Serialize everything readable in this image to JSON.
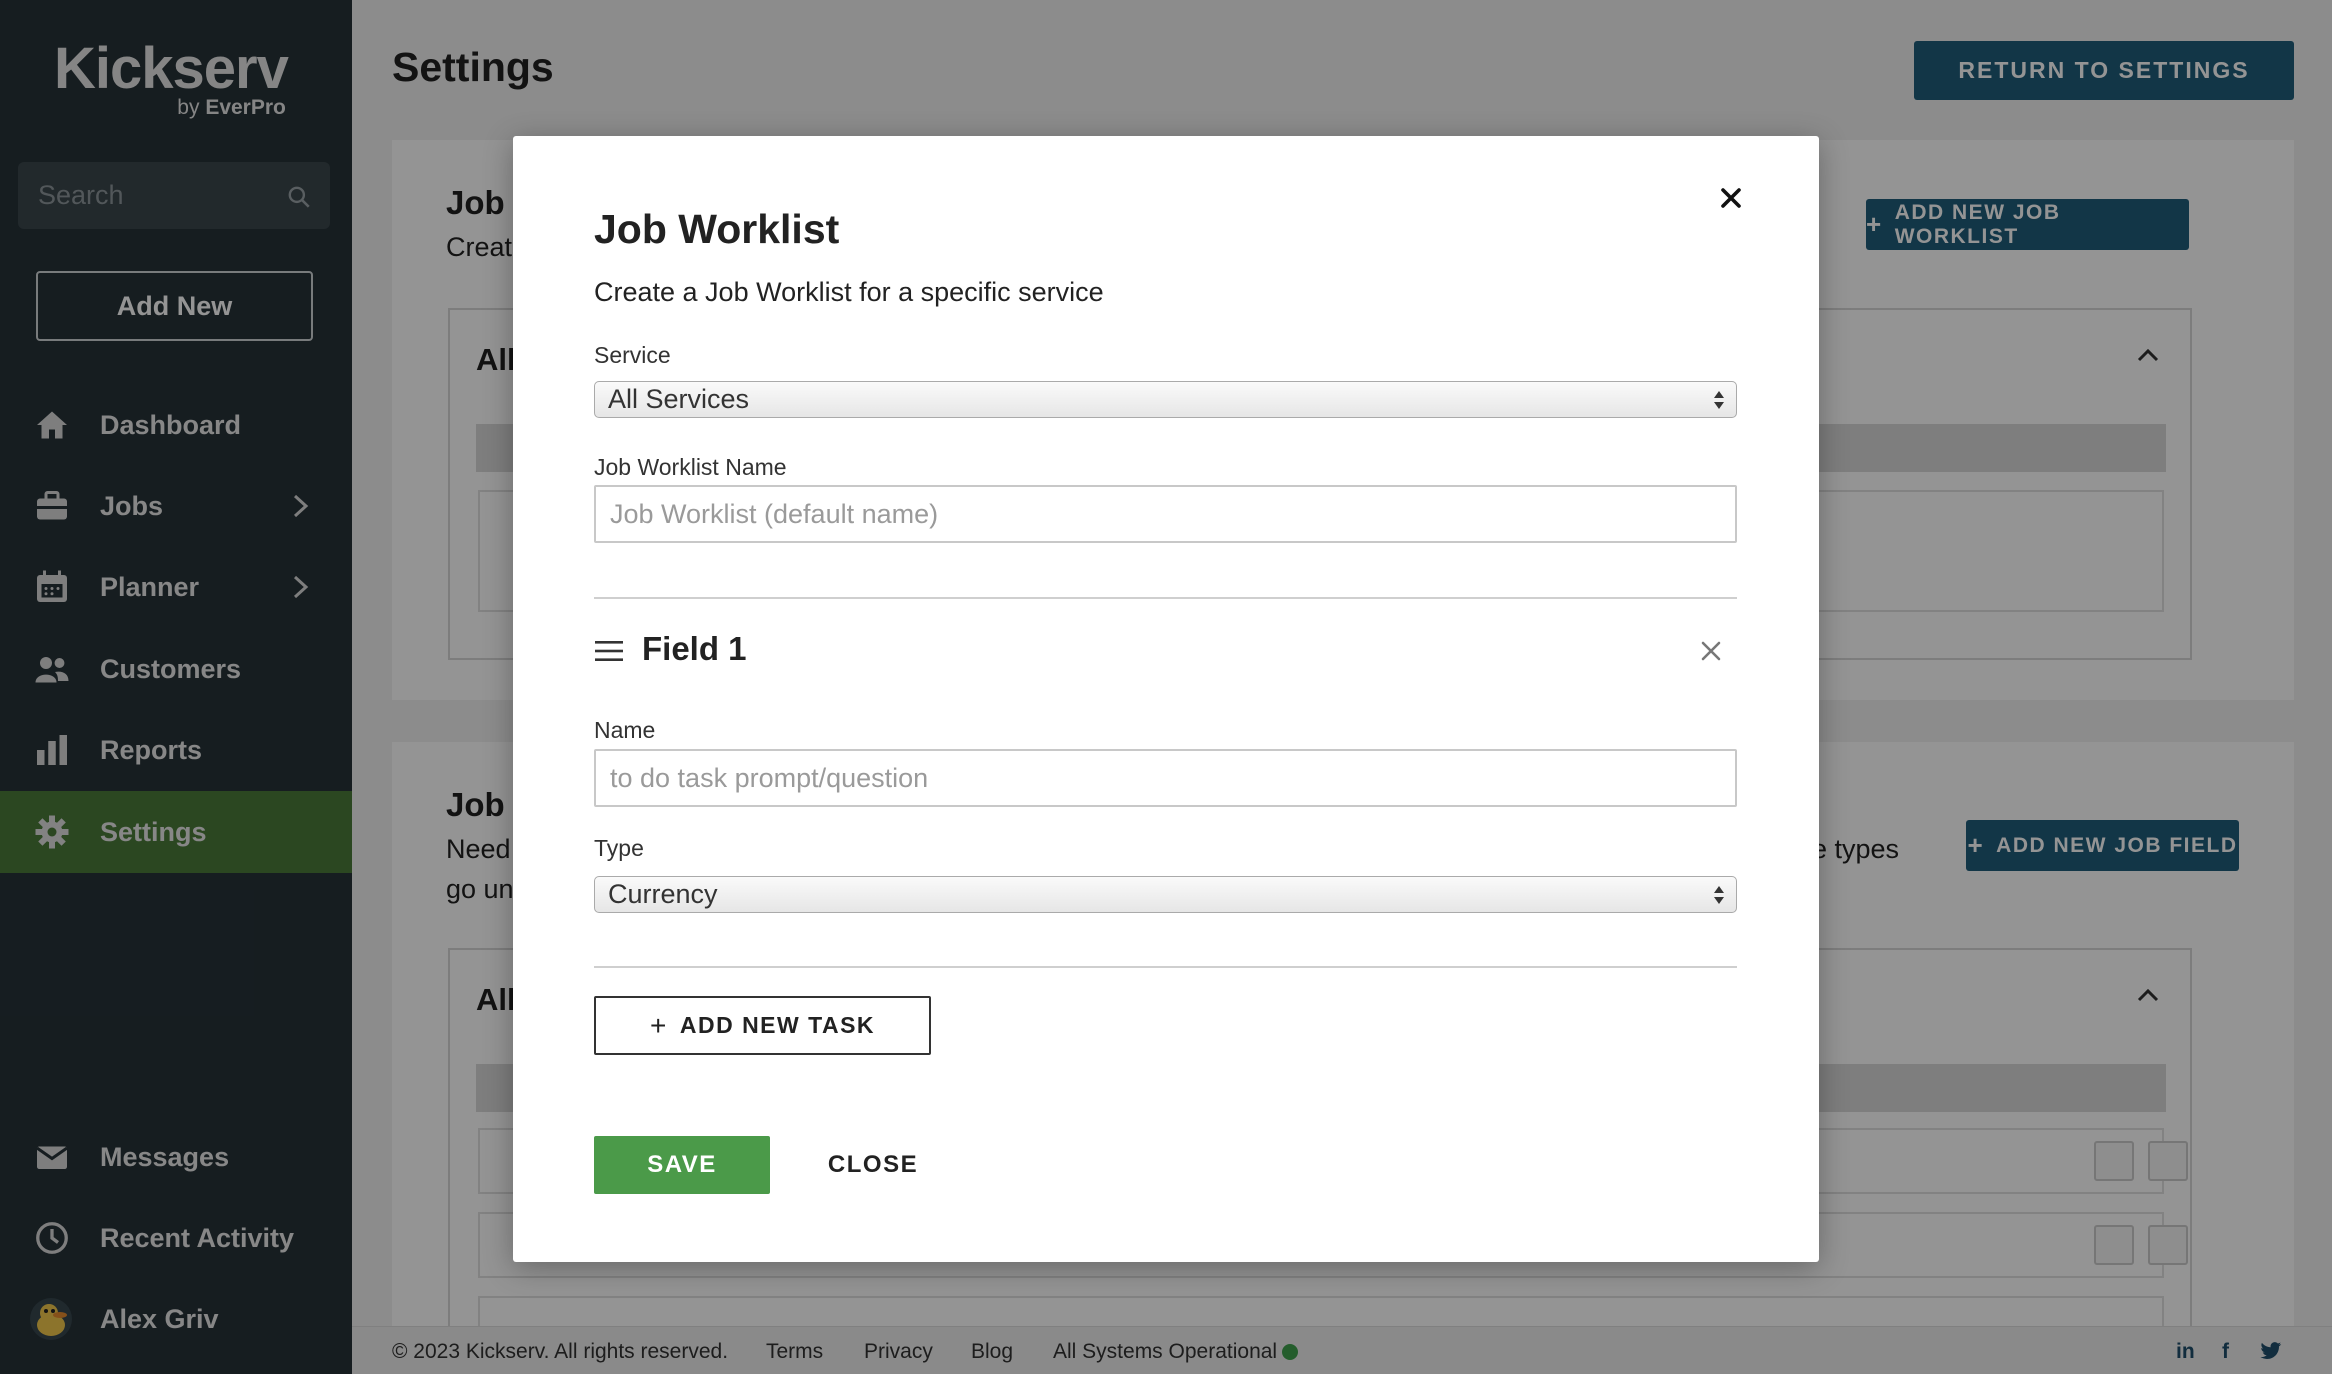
{
  "brand": {
    "name": "Kickserv",
    "byline_prefix": "by ",
    "byline_brand": "EverPro"
  },
  "sidebar": {
    "search_placeholder": "Search",
    "add_new": "Add New",
    "items": [
      {
        "label": "Dashboard",
        "icon": "home-icon"
      },
      {
        "label": "Jobs",
        "icon": "briefcase-icon",
        "has_submenu": true
      },
      {
        "label": "Planner",
        "icon": "calendar-icon",
        "has_submenu": true
      },
      {
        "label": "Customers",
        "icon": "people-icon"
      },
      {
        "label": "Reports",
        "icon": "bar-chart-icon"
      },
      {
        "label": "Settings",
        "icon": "gear-icon",
        "active": true
      }
    ],
    "bottom_items": [
      {
        "label": "Messages",
        "icon": "envelope-icon"
      },
      {
        "label": "Recent Activity",
        "icon": "clock-icon"
      },
      {
        "label": "Alex Griv",
        "icon": "avatar"
      }
    ]
  },
  "header": {
    "title": "Settings",
    "return_button": "RETURN TO SETTINGS"
  },
  "background": {
    "section1": {
      "title": "Job",
      "desc": "Creat",
      "inner_title": "All",
      "add_button": "ADD NEW JOB WORKLIST"
    },
    "section2": {
      "title": "Job",
      "desc_line1": "Need",
      "desc_line1_end": "e types",
      "desc_line2": "go un",
      "inner_title": "All",
      "add_button": "ADD NEW JOB FIELD"
    }
  },
  "footer": {
    "copyright": "© 2023 Kickserv. All rights reserved.",
    "links": [
      "Terms",
      "Privacy",
      "Blog"
    ],
    "status": "All Systems Operational",
    "status_color": "#3fa14d",
    "social": [
      "in",
      "f",
      "twitter-icon"
    ]
  },
  "modal": {
    "title": "Job Worklist",
    "subtitle": "Create a Job Worklist for a specific service",
    "service_label": "Service",
    "service_value": "All Services",
    "name_label": "Job Worklist Name",
    "name_placeholder": "Job Worklist (default name)",
    "field": {
      "title": "Field 1",
      "name_label": "Name",
      "name_placeholder": "to do task prompt/question",
      "type_label": "Type",
      "type_value": "Currency"
    },
    "add_task": "ADD NEW TASK",
    "save": "SAVE",
    "close": "CLOSE"
  },
  "colors": {
    "sidebar_bg": "#263238",
    "active_nav": "#4b7b3a",
    "primary_blue": "#1f5d7b",
    "save_green": "#4b9a49"
  }
}
